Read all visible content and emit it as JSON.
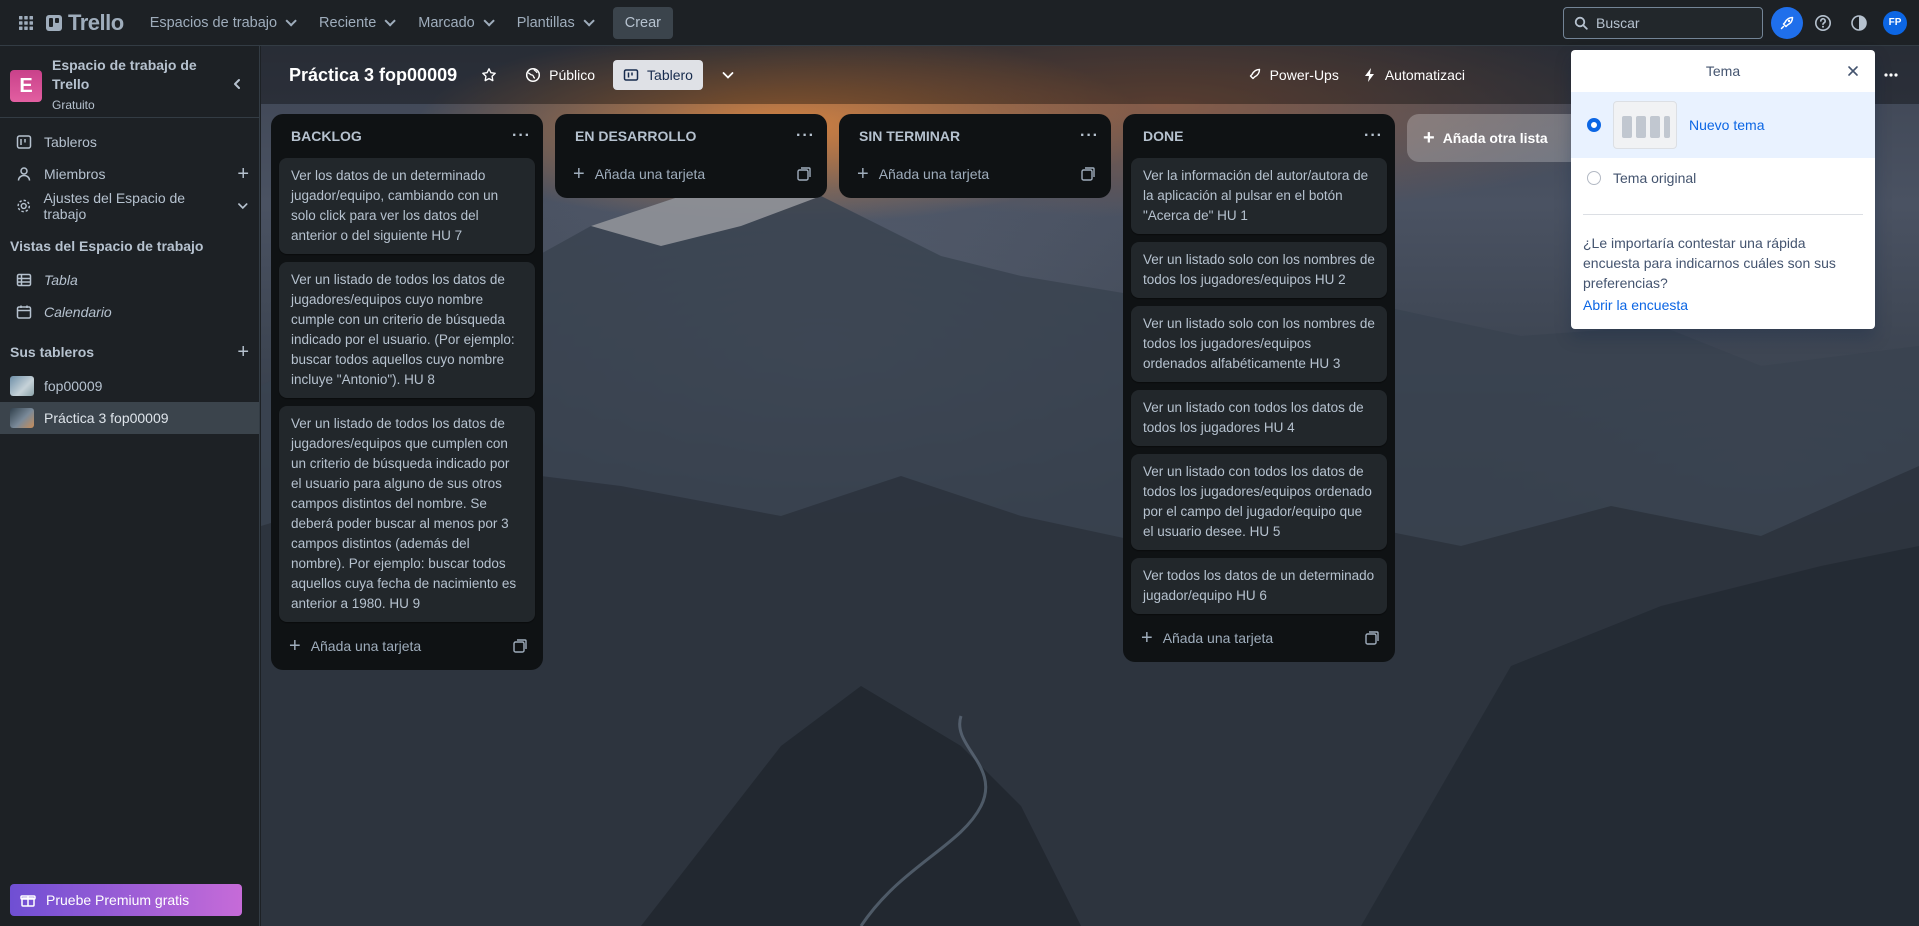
{
  "topbar": {
    "apps_icon": "grid-icon",
    "logo_text": "Trello",
    "menus": [
      "Espacios de trabajo",
      "Reciente",
      "Marcado",
      "Plantillas"
    ],
    "create_label": "Crear",
    "search_placeholder": "Buscar",
    "avatar_initials": "FP"
  },
  "sidebar": {
    "workspace_initial": "E",
    "workspace_name": "Espacio de trabajo de Trello",
    "workspace_plan": "Gratuito",
    "items": [
      {
        "label": "Tableros",
        "icon": "board-icon"
      },
      {
        "label": "Miembros",
        "icon": "person-icon"
      },
      {
        "label": "Ajustes del Espacio de trabajo",
        "icon": "gear-icon"
      }
    ],
    "views_title": "Vistas del Espacio de trabajo",
    "views": [
      {
        "label": "Tabla",
        "icon": "table-icon"
      },
      {
        "label": "Calendario",
        "icon": "calendar-icon"
      }
    ],
    "boards_title": "Sus tableros",
    "boards": [
      {
        "label": "fop00009",
        "active": false
      },
      {
        "label": "Práctica 3 fop00009",
        "active": true
      }
    ],
    "premium_label": "Pruebe Premium gratis"
  },
  "board": {
    "title": "Práctica 3 fop00009",
    "visibility": "Público",
    "view_label": "Tablero",
    "powerups": "Power-Ups",
    "automation": "Automatizaci",
    "add_list": "Añada otra lista",
    "add_card": "Añada una tarjeta"
  },
  "lists": [
    {
      "title": "BACKLOG",
      "cards": [
        "Ver los datos de un determinado jugador/equipo, cambiando con un solo click para ver los datos del anterior o del siguiente HU 7",
        "Ver un listado de todos los datos de jugadores/equipos cuyo nombre cumple con un criterio de búsqueda indicado por el usuario. (Por ejemplo: buscar todos aquellos cuyo nombre incluye \"Antonio\"). HU 8",
        "Ver un listado de todos los datos de jugadores/equipos que cumplen con un criterio de búsqueda indicado por el usuario para alguno de sus otros campos distintos del nombre. Se deberá poder buscar al menos por 3 campos distintos (además del nombre). Por ejemplo: buscar todos aquellos cuya fecha de nacimiento es anterior a 1980. HU 9"
      ]
    },
    {
      "title": "EN DESARROLLO",
      "cards": []
    },
    {
      "title": "SIN TERMINAR",
      "cards": []
    },
    {
      "title": "DONE",
      "cards": [
        "Ver la información del autor/autora de la aplicación al pulsar en el botón \"Acerca de\" HU 1",
        "Ver un listado solo con los nombres de todos los jugadores/equipos HU 2",
        "Ver un listado solo con los nombres de todos los jugadores/equipos ordenados alfabéticamente HU 3",
        "Ver un listado con todos los datos de todos los jugadores HU 4",
        "Ver un listado con todos los datos de todos los jugadores/equipos ordenado por el campo del jugador/equipo que el usuario desee. HU 5",
        "Ver todos los datos de un determinado jugador/equipo HU 6"
      ]
    }
  ],
  "theme_popover": {
    "title": "Tema",
    "option_new": "Nuevo tema",
    "option_original": "Tema original",
    "survey_text": "¿Le importaría contestar una rápida encuesta para indicarnos cuáles son sus preferencias?",
    "survey_link": "Abrir la encuesta"
  }
}
